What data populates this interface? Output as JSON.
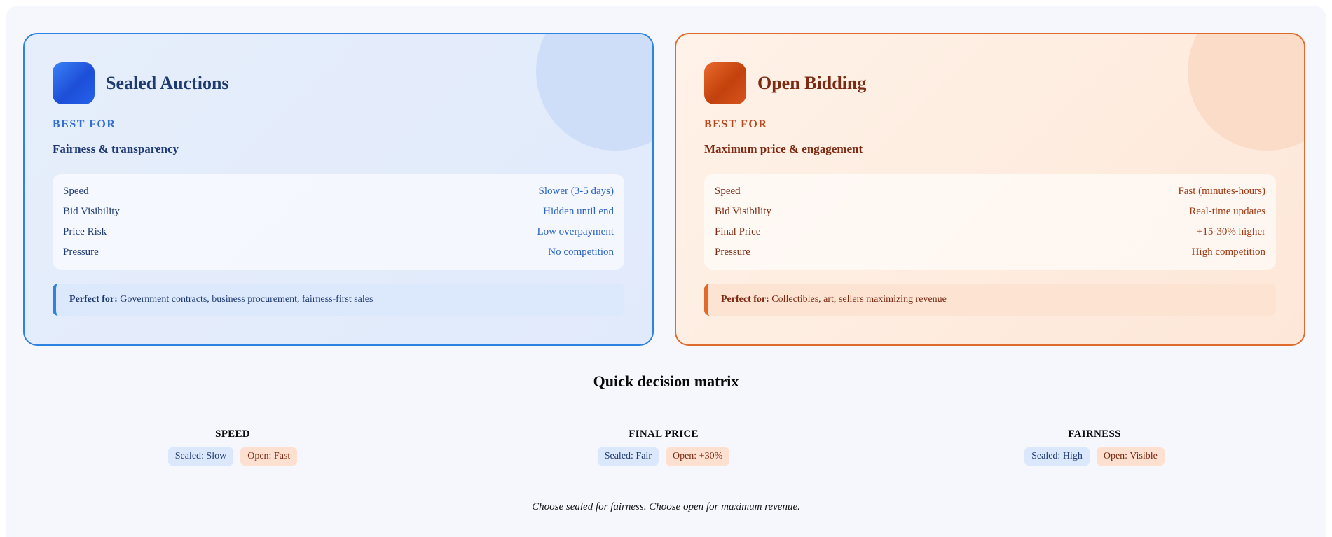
{
  "cards": {
    "sealed": {
      "title": "Sealed Auctions",
      "best_for_label": "BEST FOR",
      "best_for_value": "Fairness & transparency",
      "stats": [
        {
          "label": "Speed",
          "value": "Slower (3-5 days)"
        },
        {
          "label": "Bid Visibility",
          "value": "Hidden until end"
        },
        {
          "label": "Price Risk",
          "value": "Low overpayment"
        },
        {
          "label": "Pressure",
          "value": "No competition"
        }
      ],
      "perfect_label": "Perfect for:",
      "perfect_text": " Government contracts, business procurement, fairness-first sales",
      "accent": "#2d83e2"
    },
    "open": {
      "title": "Open Bidding",
      "best_for_label": "BEST FOR",
      "best_for_value": "Maximum price & engagement",
      "stats": [
        {
          "label": "Speed",
          "value": "Fast (minutes-hours)"
        },
        {
          "label": "Bid Visibility",
          "value": "Real-time updates"
        },
        {
          "label": "Final Price",
          "value": "+15-30% higher"
        },
        {
          "label": "Pressure",
          "value": "High competition"
        }
      ],
      "perfect_label": "Perfect for:",
      "perfect_text": " Collectibles, art, sellers maximizing revenue",
      "accent": "#e06a2b"
    }
  },
  "matrix": {
    "title": "Quick decision matrix",
    "columns": [
      {
        "heading": "SPEED",
        "sealed": "Sealed: Slow",
        "open": "Open: Fast"
      },
      {
        "heading": "FINAL PRICE",
        "sealed": "Sealed: Fair",
        "open": "Open: +30%"
      },
      {
        "heading": "FAIRNESS",
        "sealed": "Sealed: High",
        "open": "Open: Visible"
      }
    ]
  },
  "footer_note": "Choose sealed for fairness. Choose open for maximum revenue."
}
